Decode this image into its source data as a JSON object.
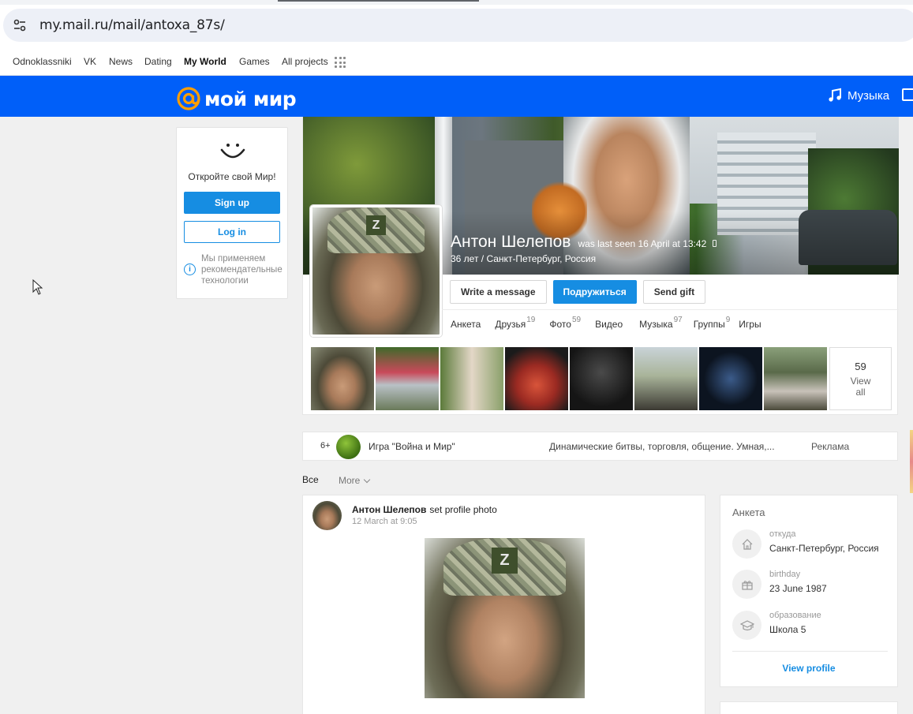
{
  "browser": {
    "url": "my.mail.ru/mail/antoxa_87s/"
  },
  "portal_nav": [
    {
      "label": "Odnoklassniki",
      "bold": false
    },
    {
      "label": "VK",
      "bold": false
    },
    {
      "label": "News",
      "bold": false
    },
    {
      "label": "Dating",
      "bold": false
    },
    {
      "label": "My World",
      "bold": true
    },
    {
      "label": "Games",
      "bold": false
    },
    {
      "label": "All projects",
      "bold": false
    }
  ],
  "header": {
    "logo_text": "мой мир",
    "music_label": "Музыка",
    "accent_color": "#005ff9"
  },
  "promo": {
    "title": "Откройте свой Мир!",
    "signup_label": "Sign up",
    "login_label": "Log in",
    "note": "Мы применяем рекомендательные технологии"
  },
  "profile": {
    "name": "Антон Шелепов",
    "last_seen": "was last seen 16 April at 13:42",
    "subtitle": "36 лет / Санкт-Петербург, Россия",
    "actions": {
      "write": "Write a message",
      "friend": "Подружиться",
      "gift": "Send gift"
    },
    "tabs": [
      {
        "label": "Анкета",
        "count": ""
      },
      {
        "label": "Друзья",
        "count": "19"
      },
      {
        "label": "Фото",
        "count": "59"
      },
      {
        "label": "Видео",
        "count": ""
      },
      {
        "label": "Музыка",
        "count": "97"
      },
      {
        "label": "Группы",
        "count": "9"
      },
      {
        "label": "Игры",
        "count": ""
      }
    ],
    "photos_total": "59",
    "view_all_label": "View all"
  },
  "ad": {
    "age": "6+",
    "title": "Игра \"Война и Мир\"",
    "description": "Динамические битвы, торговля, общение. Умная,...",
    "label": "Реклама"
  },
  "feed_filter": {
    "all_label": "Все",
    "more_label": "More"
  },
  "post": {
    "author": "Антон Шелепов",
    "action": "set profile photo",
    "time": "12 March at 9:05"
  },
  "anketa": {
    "title": "Анкета",
    "rows": [
      {
        "label": "откуда",
        "value": "Санкт-Петербург, Россия",
        "icon": "home-icon"
      },
      {
        "label": "birthday",
        "value": "23 June 1987",
        "icon": "gift-icon"
      },
      {
        "label": "образование",
        "value": "Школа 5",
        "icon": "graduation-cap-icon"
      }
    ],
    "view_profile_label": "View profile"
  }
}
